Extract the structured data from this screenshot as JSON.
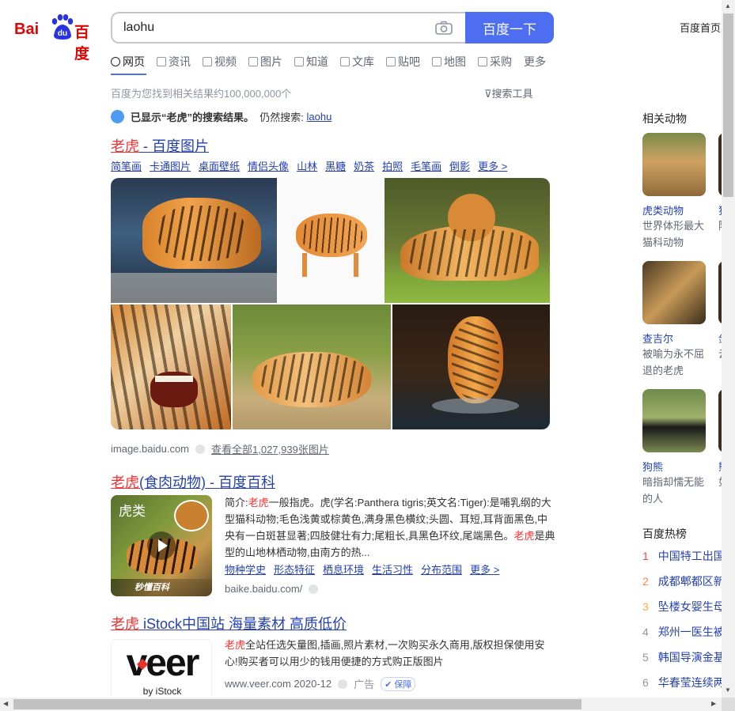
{
  "header": {
    "logo_left": "Bai",
    "logo_mid": "du",
    "logo_right": "百度",
    "query": "laohu",
    "search_button": "百度一下",
    "home_link": "百度首页"
  },
  "tabs": [
    {
      "label": "网页",
      "icon": "search-icon"
    },
    {
      "label": "资讯",
      "icon": "news-icon"
    },
    {
      "label": "视频",
      "icon": "video-icon"
    },
    {
      "label": "图片",
      "icon": "image-icon"
    },
    {
      "label": "知道",
      "icon": "question-icon"
    },
    {
      "label": "文库",
      "icon": "doc-icon"
    },
    {
      "label": "贴吧",
      "icon": "tieba-icon"
    },
    {
      "label": "地图",
      "icon": "map-icon"
    },
    {
      "label": "采购",
      "icon": "bag-icon"
    },
    {
      "label": "更多",
      "icon": ""
    }
  ],
  "result_count": "百度为您找到相关结果约100,000,000个",
  "search_tools": "搜索工具",
  "notice": {
    "main": "已显示“老虎”的搜索结果。",
    "still": "仍然搜索:",
    "link": "laohu"
  },
  "result1": {
    "title_em": "老虎",
    "title_rest": " - 百度图片",
    "sublinks": [
      "简笔画",
      "卡通图片",
      "桌面壁纸",
      "情侣头像",
      "山林",
      "黑糖",
      "奶茶",
      "拍照",
      "毛笔画",
      "倒影",
      "更多 >"
    ],
    "source": "image.baidu.com",
    "view_all": "查看全部1,027,939张图片"
  },
  "result2": {
    "title_em": "老虎",
    "title_rest": "(食肉动物) - 百度百科",
    "thumb_label": "虎类",
    "thumb_brand": "秒懂百科",
    "text_a": "简介:",
    "text_em1": "老虎",
    "text_b": "一般指虎。虎(学名:Panthera tigris;英文名:Tiger):是哺乳纲的大型猫科动物;毛色浅黄或棕黄色,满身黑色横纹;头圆、耳短,耳背面黑色,中央有一白斑甚显著;四肢健壮有力;尾粗长,具黑色环纹,尾端黑色。",
    "text_em2": "老虎",
    "text_c": "是典型的山地林栖动物,由南方的热...",
    "links": [
      "物种学史",
      "形态特征",
      "栖息环境",
      "生活习性",
      "分布范围",
      "更多 >"
    ],
    "source": "baike.baidu.com/"
  },
  "result3": {
    "title_em": "老虎",
    "title_rest": " iStock中国站 海量素材 高质低价",
    "logo_text": "veer",
    "logo_sub": "by iStock",
    "text_em": "老虎",
    "text_rest": "全站任选矢量图,插画,照片素材,一次购买永久商用,版权担保使用安心!购买者可以用少的钱用便捷的方式购正版图片",
    "source": "www.veer.com 2020-12",
    "ad": "广告",
    "badge": "保障"
  },
  "related": {
    "heading": "相关动物",
    "items": [
      {
        "name": "虎类动物",
        "desc": "世界体形最大猫科动物"
      },
      {
        "name": "查吉尔",
        "desc": "被喻为永不屈退的老虎"
      },
      {
        "name": "狗熊",
        "desc": "暗指却懦无能的人"
      }
    ],
    "partial": [
      {
        "name": "猫",
        "desc": "陆地"
      },
      {
        "name": "剑",
        "desc": "云豹"
      },
      {
        "name": "熊",
        "desc": "如熊"
      }
    ]
  },
  "hot": {
    "heading": "百度热榜",
    "items": [
      {
        "rank": "1",
        "title": "中国特工出国"
      },
      {
        "rank": "2",
        "title": "成都郫都区新"
      },
      {
        "rank": "3",
        "title": "坠楼女婴生母"
      },
      {
        "rank": "4",
        "title": "郑州一医生被"
      },
      {
        "rank": "5",
        "title": "韩国导演金基"
      },
      {
        "rank": "6",
        "title": "华春莹连续两"
      }
    ],
    "rank_colors": [
      "#f54545",
      "#ff8547",
      "#ffac38",
      "#9195a3",
      "#9195a3",
      "#9195a3"
    ]
  },
  "colors": {
    "brand_blue": "#4e6ef2",
    "link": "#2440b3",
    "highlight": "#f73131"
  }
}
